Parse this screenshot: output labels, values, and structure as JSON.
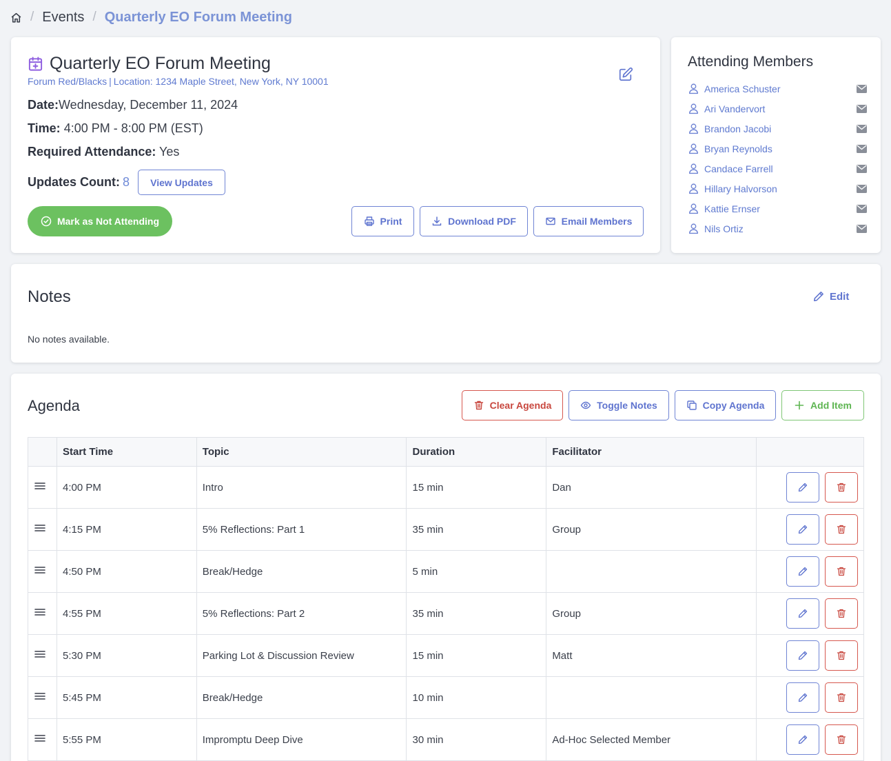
{
  "breadcrumb": {
    "icon": "home-icon",
    "items": [
      "Events",
      "Quarterly EO Forum Meeting"
    ]
  },
  "event": {
    "title": "Quarterly EO Forum Meeting",
    "icon": "calendar-plus-icon",
    "forum": "Forum Red/Blacks",
    "separator": "|",
    "location": "Location: 1234 Maple Street, New York, NY 10001",
    "date_label": "Date:",
    "date_value": "Wednesday, December 11, 2024",
    "time_label": "Time:",
    "time_value": "4:00 PM - 8:00 PM (EST)",
    "required_label": "Required Attendance:",
    "required_value": "Yes",
    "updates_label": "Updates Count:",
    "updates_count": "8",
    "view_updates_label": "View Updates",
    "not_attending_label": "Mark as Not Attending",
    "print_label": "Print",
    "download_pdf_label": "Download PDF",
    "email_members_label": "Email Members"
  },
  "members": {
    "title": "Attending Members",
    "list": [
      "America Schuster",
      "Ari Vandervort",
      "Brandon Jacobi",
      "Bryan Reynolds",
      "Candace Farrell",
      "Hillary Halvorson",
      "Kattie Ernser",
      "Nils Ortiz"
    ]
  },
  "notes": {
    "title": "Notes",
    "edit_label": "Edit",
    "empty_text": "No notes available."
  },
  "agenda": {
    "title": "Agenda",
    "clear_label": "Clear Agenda",
    "toggle_notes_label": "Toggle Notes",
    "copy_label": "Copy Agenda",
    "add_label": "Add Item",
    "columns": [
      "Start Time",
      "Topic",
      "Duration",
      "Facilitator"
    ],
    "rows": [
      {
        "start": "4:00 PM",
        "topic": "Intro",
        "duration": "15 min",
        "facilitator": "Dan"
      },
      {
        "start": "4:15 PM",
        "topic": "5% Reflections: Part 1",
        "duration": "35 min",
        "facilitator": "Group"
      },
      {
        "start": "4:50 PM",
        "topic": "Break/Hedge",
        "duration": "5 min",
        "facilitator": ""
      },
      {
        "start": "4:55 PM",
        "topic": "5% Reflections: Part 2",
        "duration": "35 min",
        "facilitator": "Group"
      },
      {
        "start": "5:30 PM",
        "topic": "Parking Lot & Discussion Review",
        "duration": "15 min",
        "facilitator": "Matt"
      },
      {
        "start": "5:45 PM",
        "topic": "Break/Hedge",
        "duration": "10 min",
        "facilitator": ""
      },
      {
        "start": "5:55 PM",
        "topic": "Impromptu Deep Dive",
        "duration": "30 min",
        "facilitator": "Ad-Hoc Selected Member"
      }
    ]
  },
  "colors": {
    "accent_blue": "#5f74cf",
    "danger_red": "#c8473e",
    "success_green": "#6cc160",
    "calendar_purple": "#8f5fe0",
    "page_bg": "#f1f3f6"
  }
}
